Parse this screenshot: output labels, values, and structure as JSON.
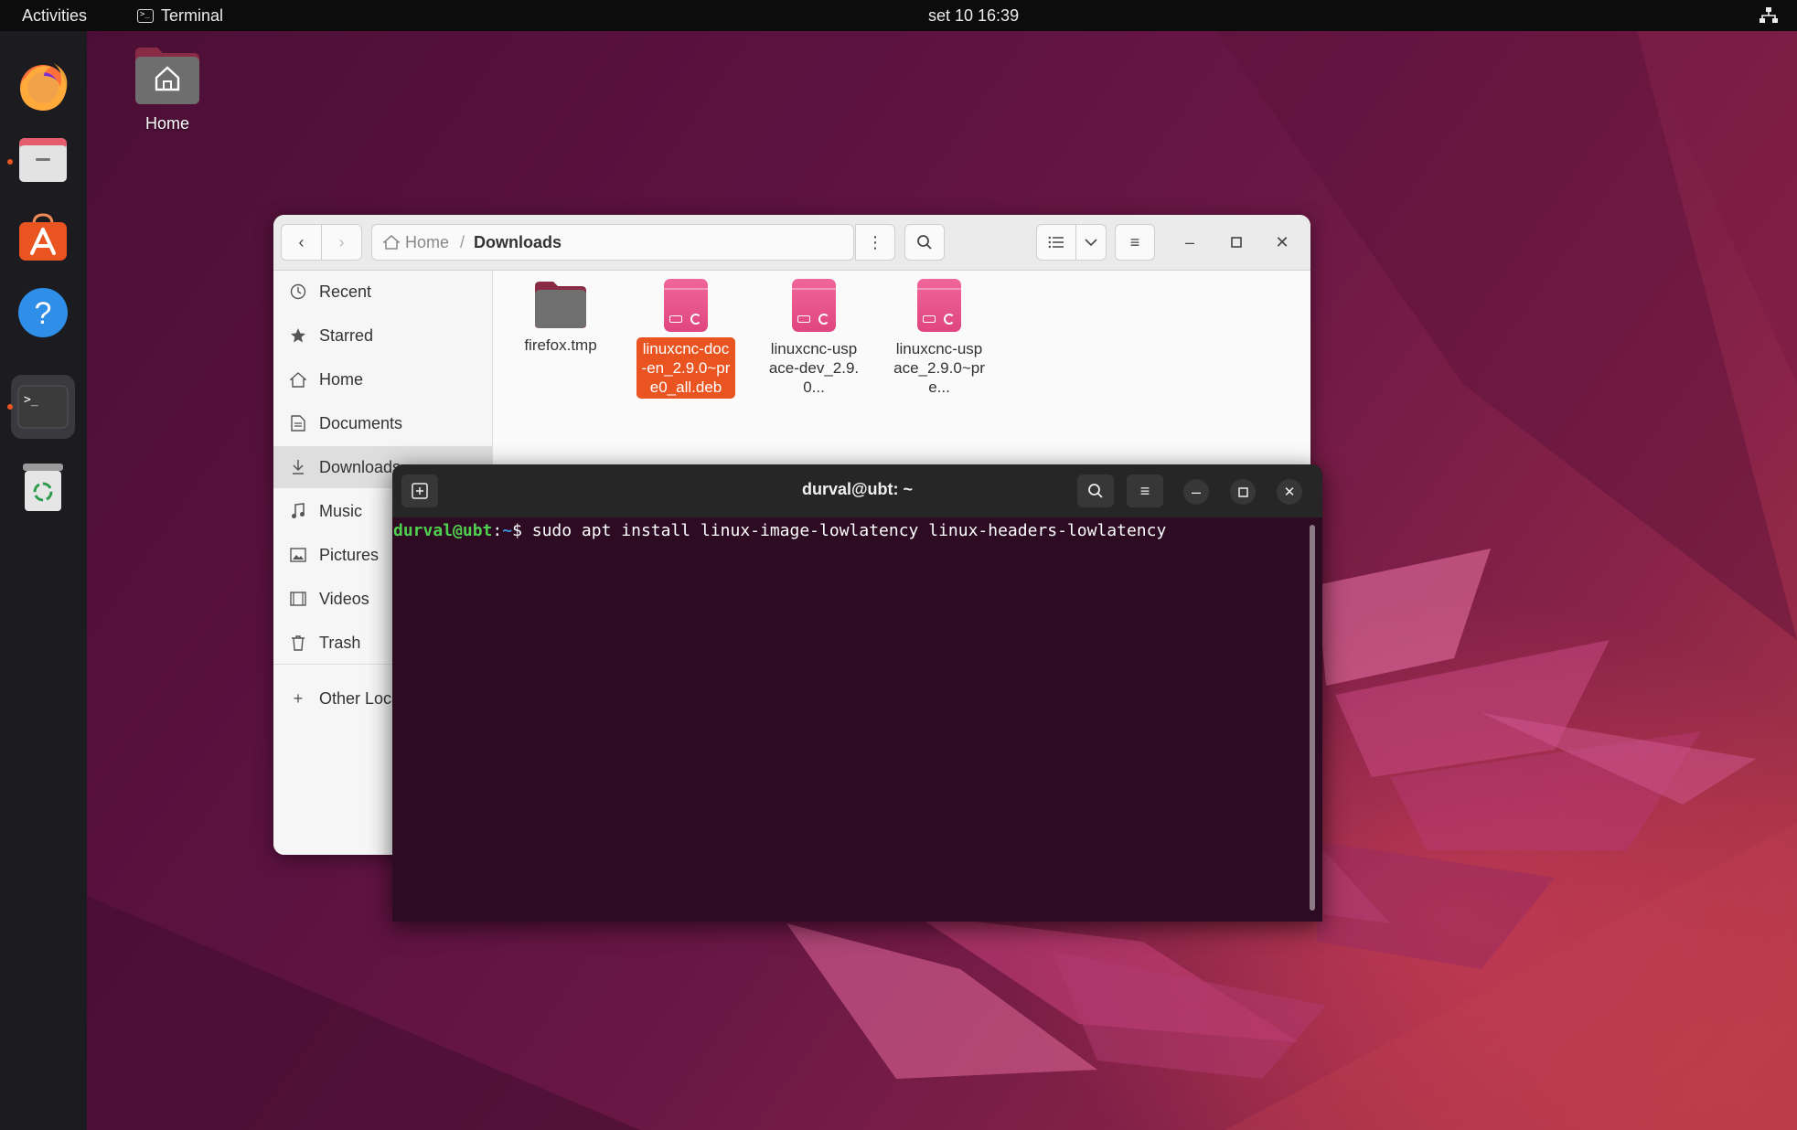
{
  "topbar": {
    "activities": "Activities",
    "app_name": "Terminal",
    "clock": "set 10  16:39"
  },
  "desktop": {
    "home_label": "Home"
  },
  "file_manager": {
    "path_home": "Home",
    "path_current": "Downloads",
    "sidebar": [
      {
        "label": "Recent",
        "icon": "clock-icon"
      },
      {
        "label": "Starred",
        "icon": "star-icon"
      },
      {
        "label": "Home",
        "icon": "home-icon"
      },
      {
        "label": "Documents",
        "icon": "document-icon"
      },
      {
        "label": "Downloads",
        "icon": "download-icon"
      },
      {
        "label": "Music",
        "icon": "music-icon"
      },
      {
        "label": "Pictures",
        "icon": "pictures-icon"
      },
      {
        "label": "Videos",
        "icon": "videos-icon"
      },
      {
        "label": "Trash",
        "icon": "trash-icon"
      },
      {
        "label": "Other Locations",
        "icon": "plus-icon"
      }
    ],
    "files": [
      {
        "name": "firefox.tmp",
        "type": "folder"
      },
      {
        "name": "linuxcnc-doc-en_2.9.0~pre0_all.deb",
        "type": "deb"
      },
      {
        "name": "linuxcnc-uspace-dev_2.9.0...",
        "type": "deb"
      },
      {
        "name": "linuxcnc-uspace_2.9.0~pre...",
        "type": "deb"
      }
    ]
  },
  "terminal": {
    "title": "durval@ubt: ~",
    "prompt_user": "durval@ubt",
    "prompt_path": "~",
    "prompt_symbol": "$",
    "command": "sudo apt install linux-image-lowlatency linux-headers-lowlatency"
  },
  "colors": {
    "accent": "#e95420",
    "terminal_bg": "#2c0b23",
    "prompt_green": "#4fd14f",
    "prompt_blue": "#3f8fd6"
  }
}
